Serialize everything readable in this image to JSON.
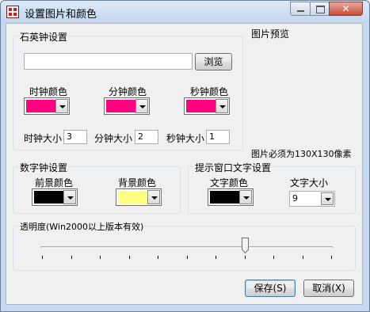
{
  "window": {
    "title": "设置图片和颜色"
  },
  "quartz": {
    "legend": "石英钟设置",
    "file_path": "",
    "browse_label": "浏览",
    "hour_color_label": "时钟颜色",
    "minute_color_label": "分钟颜色",
    "second_color_label": "秒钟颜色",
    "hour_size_label": "时钟大小",
    "hour_size": "3",
    "minute_size_label": "分钟大小",
    "minute_size": "2",
    "second_size_label": "秒钟大小",
    "second_size": "1"
  },
  "preview": {
    "label": "图片预览",
    "note": "图片必须为130X130像素"
  },
  "digital": {
    "legend": "数字钟设置",
    "foreground_label": "前景颜色",
    "background_label": "背景颜色"
  },
  "tip": {
    "legend": "提示窗口文字设置",
    "text_color_label": "文字颜色",
    "text_size_label": "文字大小",
    "text_size_value": "9"
  },
  "transparency": {
    "legend": "透明度(Win2000以上版本有效)",
    "level_fraction": 0.7
  },
  "footer": {
    "save_label": "保存(S)",
    "cancel_label": "取消(X)"
  },
  "colors": {
    "hour_hand": "#ff0080",
    "minute_hand": "#ff0080",
    "second_hand": "#ff0080",
    "digital_foreground": "#000000",
    "digital_background": "#ffff80",
    "tip_text": "#000000"
  }
}
